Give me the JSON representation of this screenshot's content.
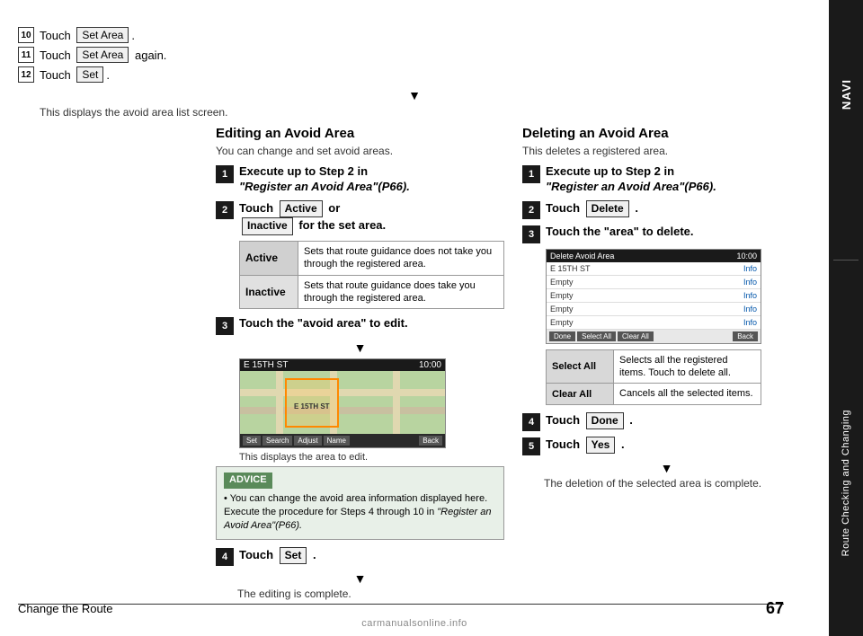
{
  "sidebar": {
    "navi_label": "NAVI",
    "route_label": "Route Checking and Changing"
  },
  "left_steps": {
    "step10": {
      "num": "10",
      "text": "Touch",
      "btn": "Set Area",
      "suffix": "."
    },
    "step11": {
      "num": "11",
      "text": "Touch",
      "btn": "Set Area",
      "suffix": "again."
    },
    "step12": {
      "num": "12",
      "text": "Touch",
      "btn": "Set",
      "suffix": "."
    },
    "arrow": "▼",
    "desc": "This displays the avoid area list screen."
  },
  "middle_section": {
    "title": "Editing an Avoid Area",
    "subtitle": "You can change and set avoid areas.",
    "step1": {
      "num": "1",
      "text": "Execute up to Step 2 in",
      "italic": "\"Register an Avoid Area\"(P66)."
    },
    "step2": {
      "num": "2",
      "text1": "Touch",
      "btn1": "Active",
      "text2": "or",
      "btn2": "Inactive",
      "text3": "for the set area."
    },
    "active_table": {
      "active_label": "Active",
      "active_desc": "Sets that route guidance does not take you through the registered area.",
      "inactive_label": "Inactive",
      "inactive_desc": "Sets that route guidance does take you through the registered area."
    },
    "step3": {
      "num": "3",
      "text": "Touch the \"avoid area\" to edit."
    },
    "arrow": "▼",
    "map": {
      "street": "E 15TH ST",
      "time": "10:00",
      "buttons": [
        "Set",
        "Search",
        "Adjust",
        "Name",
        "Back"
      ]
    },
    "map_caption": "This displays the area to edit.",
    "advice": {
      "title": "ADVICE",
      "bullet": "•",
      "text1": "You can change the avoid area information displayed here. Execute the procedure for Steps 4 through 10 in",
      "italic": "\"Register an Avoid Area\"(P66)."
    },
    "step4": {
      "num": "4",
      "text": "Touch",
      "btn": "Set",
      "suffix": "."
    },
    "arrow2": "▼",
    "complete": "The editing is complete."
  },
  "right_section": {
    "title": "Deleting an Avoid Area",
    "subtitle": "This deletes a registered area.",
    "step1": {
      "num": "1",
      "text": "Execute up to Step 2 in",
      "italic": "\"Register an Avoid Area\"(P66)."
    },
    "step2": {
      "num": "2",
      "text": "Touch",
      "btn": "Delete",
      "suffix": "."
    },
    "step3": {
      "num": "3",
      "text": "Touch the \"area\" to delete."
    },
    "delete_screen": {
      "header_left": "Delete Avoid Area",
      "header_right": "10:00",
      "rows": [
        {
          "label": "E 15TH ST",
          "info": "Info"
        },
        {
          "label": "Empty",
          "info": "Info"
        },
        {
          "label": "Empty",
          "info": "Info"
        },
        {
          "label": "Empty",
          "info": "Info"
        },
        {
          "label": "Empty",
          "info": "Info"
        }
      ],
      "footer_buttons": [
        "Done",
        "Select All",
        "Clear All",
        "Back"
      ]
    },
    "select_clear_table": {
      "select_label": "Select All",
      "select_desc": "Selects all the registered items. Touch to delete all.",
      "clear_label": "Clear All",
      "clear_desc": "Cancels all the selected items."
    },
    "step4": {
      "num": "4",
      "text": "Touch",
      "btn": "Done",
      "suffix": "."
    },
    "step5": {
      "num": "5",
      "text": "Touch",
      "btn": "Yes",
      "suffix": "."
    },
    "arrow": "▼",
    "complete": "The deletion of the selected area is complete."
  },
  "bottom": {
    "page_label": "Change the Route",
    "page_num": "67"
  }
}
